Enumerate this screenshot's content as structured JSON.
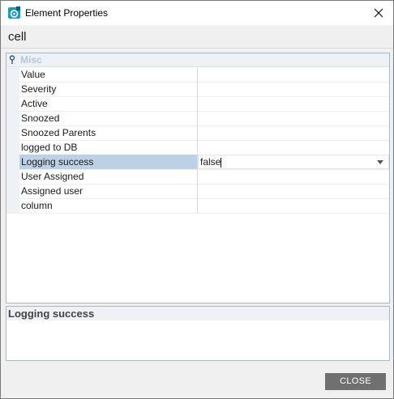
{
  "window": {
    "title": "Element Properties",
    "heading": "cell"
  },
  "category": {
    "label": "Misc",
    "toggle_icon": "pin-icon"
  },
  "properties": [
    {
      "name": "Value",
      "value": ""
    },
    {
      "name": "Severity",
      "value": ""
    },
    {
      "name": "Active",
      "value": ""
    },
    {
      "name": "Snoozed",
      "value": ""
    },
    {
      "name": "Snoozed Parents",
      "value": ""
    },
    {
      "name": "logged to DB",
      "value": ""
    },
    {
      "name": "Logging success",
      "value": "false",
      "selected": true
    },
    {
      "name": "User Assigned",
      "value": ""
    },
    {
      "name": "Assigned user",
      "value": ""
    },
    {
      "name": "column",
      "value": ""
    }
  ],
  "description": {
    "title": "Logging success",
    "text": ""
  },
  "footer": {
    "close_label": "CLOSE"
  },
  "colors": {
    "accent_icon": "#1f9bb5",
    "selection": "#bcd1e6",
    "button": "#707070"
  }
}
